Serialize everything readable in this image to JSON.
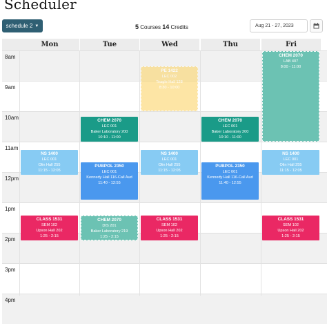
{
  "header": {
    "title": "Scheduler",
    "schedule_button": "schedule 2",
    "courses_count": "5",
    "courses_label": "Courses",
    "credits_count": "14",
    "credits_label": "Credits",
    "date_range": "Aug 21 - 27, 2023"
  },
  "days": [
    "Mon",
    "Tue",
    "Wed",
    "Thu",
    "Fri"
  ],
  "hours": [
    "8am",
    "9am",
    "10am",
    "11am",
    "12pm",
    "1pm",
    "2pm",
    "3pm",
    "4pm"
  ],
  "colors": {
    "orange": "#fcd56b",
    "teal": "#1a9b88",
    "blue": "#4a98ee",
    "lightblue": "#87cbf3",
    "red": "#ea2864",
    "tealfaded": "#6cc2b3"
  },
  "events": [
    {
      "code": "PE 1422",
      "section": "LEC 002",
      "location": "Teagle Hall 128",
      "time": "8:30 - 10:00",
      "day": "Wed",
      "color": "orange",
      "style": "dashed"
    },
    {
      "code": "CHEM 2070",
      "section": "LAB 407",
      "location": "",
      "time": "8:00 - 11:00",
      "day": "Fri",
      "color": "tealfaded",
      "style": "dashed"
    },
    {
      "code": "CHEM 2070",
      "section": "LEC 001",
      "location": "Baker Laboratory 200",
      "time": "10:10 - 11:00",
      "day": "Tue",
      "color": "teal",
      "style": "solid"
    },
    {
      "code": "CHEM 2070",
      "section": "LEC 001",
      "location": "Baker Laboratory 200",
      "time": "10:10 - 11:00",
      "day": "Thu",
      "color": "teal",
      "style": "solid"
    },
    {
      "code": "NS 1400",
      "section": "LEC 001",
      "location": "Olin Hall 255",
      "time": "11:15 - 12:05",
      "day": "Mon",
      "color": "lightblue",
      "style": "solid"
    },
    {
      "code": "NS 1400",
      "section": "LEC 001",
      "location": "Olin Hall 255",
      "time": "11:15 - 12:05",
      "day": "Wed",
      "color": "lightblue",
      "style": "solid"
    },
    {
      "code": "NS 1400",
      "section": "LEC 001",
      "location": "Olin Hall 255",
      "time": "11:15 - 12:05",
      "day": "Fri",
      "color": "lightblue",
      "style": "solid"
    },
    {
      "code": "PUBPOL 2350",
      "section": "LEC 001",
      "location": "Kennedy Hall 116-Call Aud",
      "time": "11:40 - 12:55",
      "day": "Tue",
      "color": "blue",
      "style": "solid"
    },
    {
      "code": "PUBPOL 2350",
      "section": "LEC 001",
      "location": "Kennedy Hall 116-Call Aud",
      "time": "11:40 - 12:55",
      "day": "Thu",
      "color": "blue",
      "style": "solid"
    },
    {
      "code": "CLASS 1531",
      "section": "SEM 102",
      "location": "Upson Hall 202",
      "time": "1:25 - 2:15",
      "day": "Mon",
      "color": "red",
      "style": "solid"
    },
    {
      "code": "CHEM 2070",
      "section": "DIS 201",
      "location": "Baker Laboratory 219",
      "time": "1:25 - 2:15",
      "day": "Tue",
      "color": "tealfaded",
      "style": "dashed"
    },
    {
      "code": "CLASS 1531",
      "section": "SEM 102",
      "location": "Upson Hall 202",
      "time": "1:25 - 2:15",
      "day": "Wed",
      "color": "red",
      "style": "solid"
    },
    {
      "code": "CLASS 1531",
      "section": "SEM 102",
      "location": "Upson Hall 202",
      "time": "1:25 - 2:15",
      "day": "Fri",
      "color": "red",
      "style": "solid"
    }
  ]
}
